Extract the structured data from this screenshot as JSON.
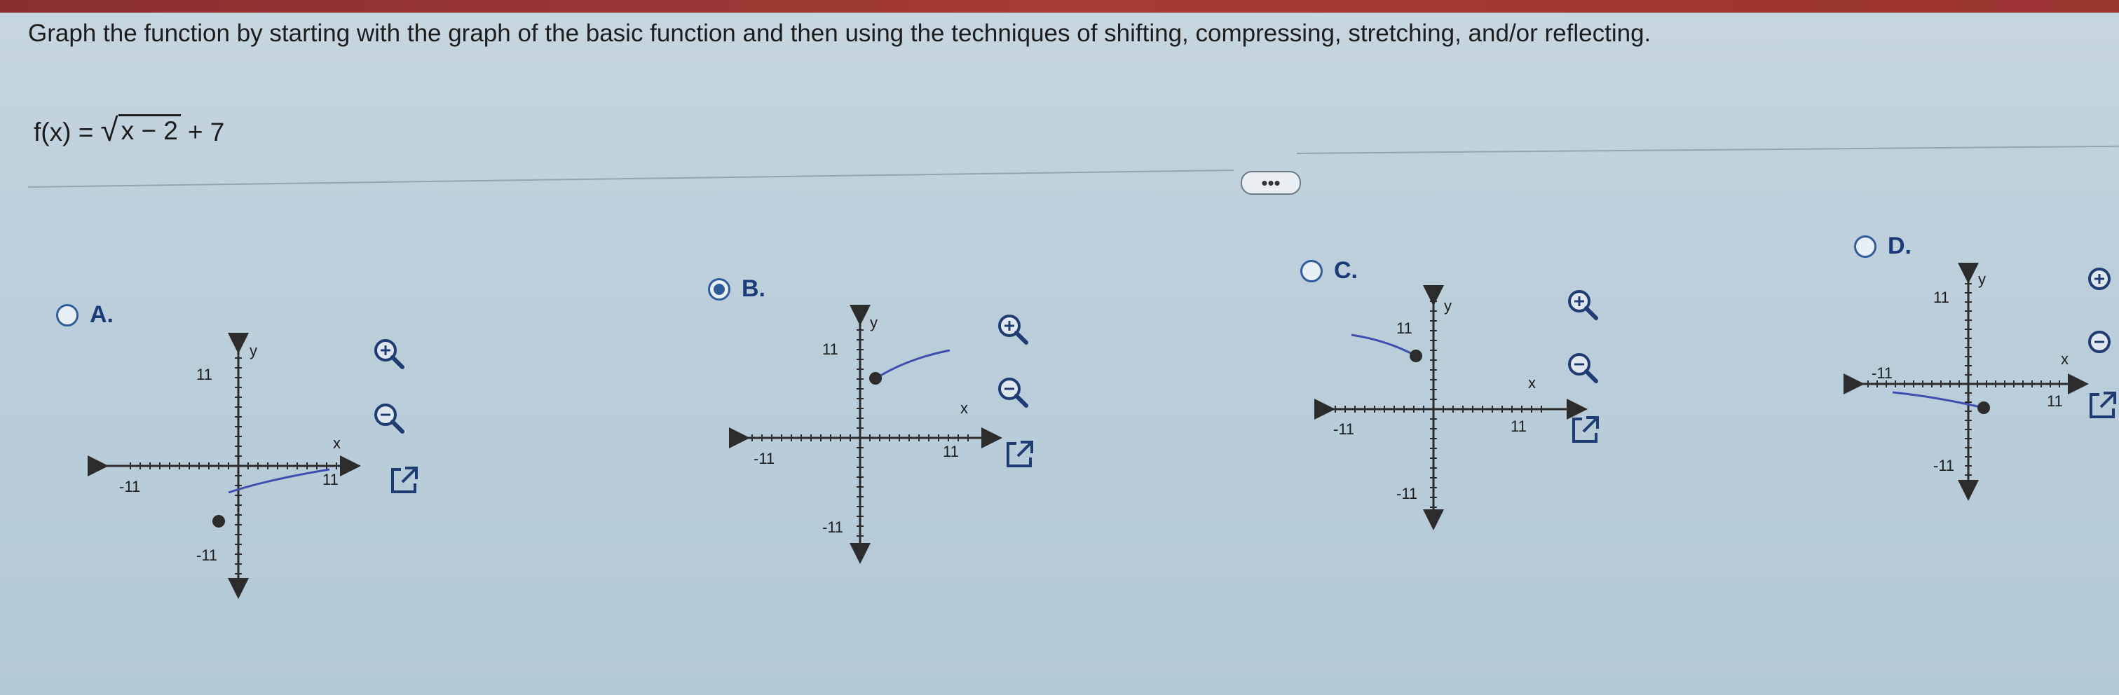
{
  "question": "Graph the function by starting with the graph of the basic function and then using the techniques of shifting, compressing, stretching, and/or reflecting.",
  "formula": {
    "lhs": "f(x) =",
    "radicand": "x − 2",
    "tail": "+ 7"
  },
  "more_button": "•••",
  "axis_labels": {
    "x": "x",
    "y": "y",
    "pos": "11",
    "neg": "-11"
  },
  "options": [
    {
      "label": "A.",
      "selected": false
    },
    {
      "label": "B.",
      "selected": true
    },
    {
      "label": "C.",
      "selected": false
    },
    {
      "label": "D.",
      "selected": false
    }
  ],
  "tools": [
    "zoom-in-icon",
    "zoom-out-icon",
    "pop-out-icon"
  ],
  "colors": {
    "curve": "#3f4fb0",
    "radio": "#2f5d9b",
    "label": "#1a3a78"
  }
}
